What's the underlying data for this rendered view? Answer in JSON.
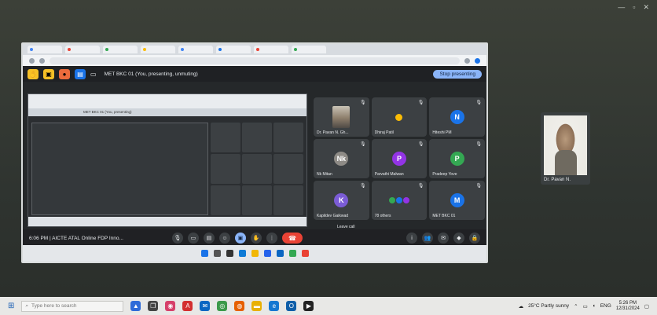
{
  "presenting_label": "MET BKC 01 (You, presenting, unmuting)",
  "stop_presenting_label": "Stop presenting",
  "meet_time_title": "6:06 PM  |  AICTE ATAL Online FDP Inno...",
  "leave_call_label": "Leave call",
  "nested_tab_label": "MET BKC 01 (You, presenting)",
  "participants": [
    {
      "name": "Dr. Pavan N. Gh...",
      "initial": "",
      "color": "#3c4043",
      "type": "camera"
    },
    {
      "name": "Dhiraj Patil",
      "initial": "",
      "color": "#3c4043",
      "type": "dot"
    },
    {
      "name": "Hiteshi PM",
      "initial": "N",
      "color": "#1a73e8",
      "type": "avatar"
    },
    {
      "name": "Nk Mitan",
      "initial": "Nk",
      "color": "#8e8b86",
      "type": "avatar"
    },
    {
      "name": "Parvathi Malwan",
      "initial": "P",
      "color": "#9334e6",
      "type": "avatar"
    },
    {
      "name": "Pradeep Yove",
      "initial": "P",
      "color": "#34a853",
      "type": "avatar"
    },
    {
      "name": "Kapildev Gaikwad",
      "initial": "K",
      "color": "#7b5cd6",
      "type": "avatar"
    },
    {
      "name": "78 others",
      "initial": "",
      "color": "#3c4043",
      "type": "group"
    },
    {
      "name": "MET BKC 01",
      "initial": "M",
      "color": "#1a73e8",
      "type": "avatar"
    }
  ],
  "self_view_name": "Dr. Pavan N.",
  "taskbar": {
    "search_placeholder": "Type here to search",
    "weather": "25°C  Partly sunny",
    "lang": "ENG",
    "time": "5:26 PM",
    "date": "12/31/2024"
  },
  "colors": {
    "end_call": "#ea4335",
    "accent": "#8ab4f8"
  }
}
